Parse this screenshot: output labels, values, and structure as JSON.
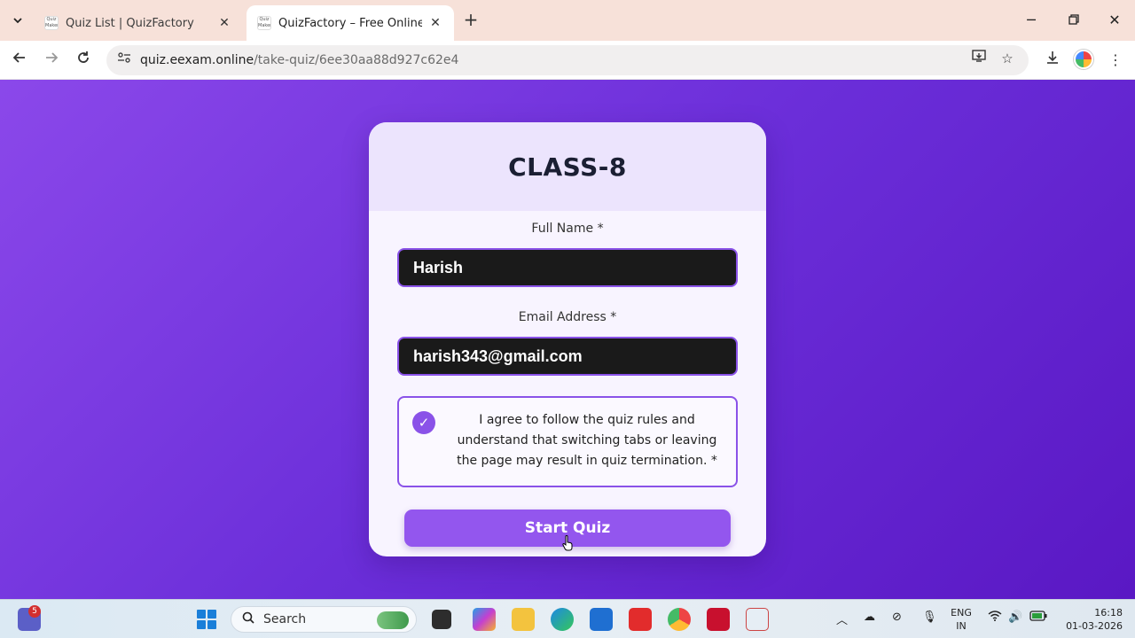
{
  "browser": {
    "tabs": [
      {
        "title": "Quiz List | QuizFactory",
        "favicon_text": "Quiz Maker"
      },
      {
        "title": "QuizFactory – Free Online Quiz",
        "favicon_text": "Quiz Maker"
      }
    ],
    "url_host": "quiz.eexam.online",
    "url_path": "/take-quiz/6ee30aa88d927c62e4"
  },
  "quiz": {
    "title": "CLASS-8",
    "full_name_label": "Full Name *",
    "full_name_value": "Harish",
    "email_label": "Email Address *",
    "email_value": "harish343@gmail.com",
    "agreement_text": "I agree to follow the quiz rules and understand that switching tabs or leaving the page may result in quiz termination. *",
    "agreement_checked": true,
    "start_button_label": "Start Quiz"
  },
  "taskbar": {
    "notification_count": "5",
    "search_placeholder": "Search",
    "language_line1": "ENG",
    "language_line2": "IN",
    "time": "16:18",
    "date": "01-03-2026"
  },
  "colors": {
    "accent": "#8a52e8",
    "page_gradient_start": "#8b48ea",
    "page_gradient_end": "#5a18c4",
    "button": "#9356ee"
  }
}
